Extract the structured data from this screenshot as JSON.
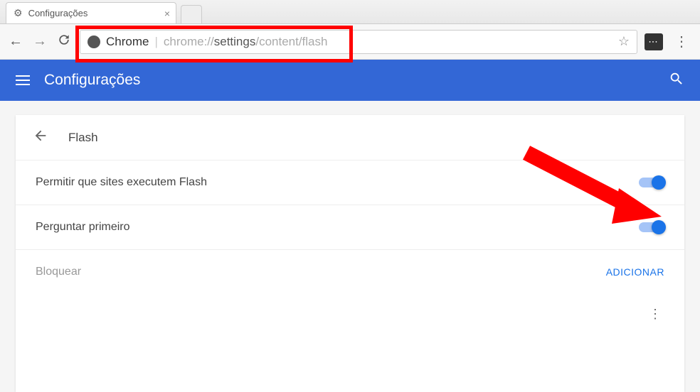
{
  "tab": {
    "title": "Configurações"
  },
  "address": {
    "scheme_label": "Chrome",
    "url_prefix": "chrome://",
    "url_mid": "settings",
    "url_suffix": "/content/flash"
  },
  "header": {
    "title": "Configurações"
  },
  "page": {
    "title": "Flash",
    "rows": [
      {
        "label": "Permitir que sites executem Flash",
        "toggle": true
      },
      {
        "label": "Perguntar primeiro",
        "toggle": true
      }
    ],
    "block_label": "Bloquear",
    "add_label": "ADICIONAR"
  }
}
